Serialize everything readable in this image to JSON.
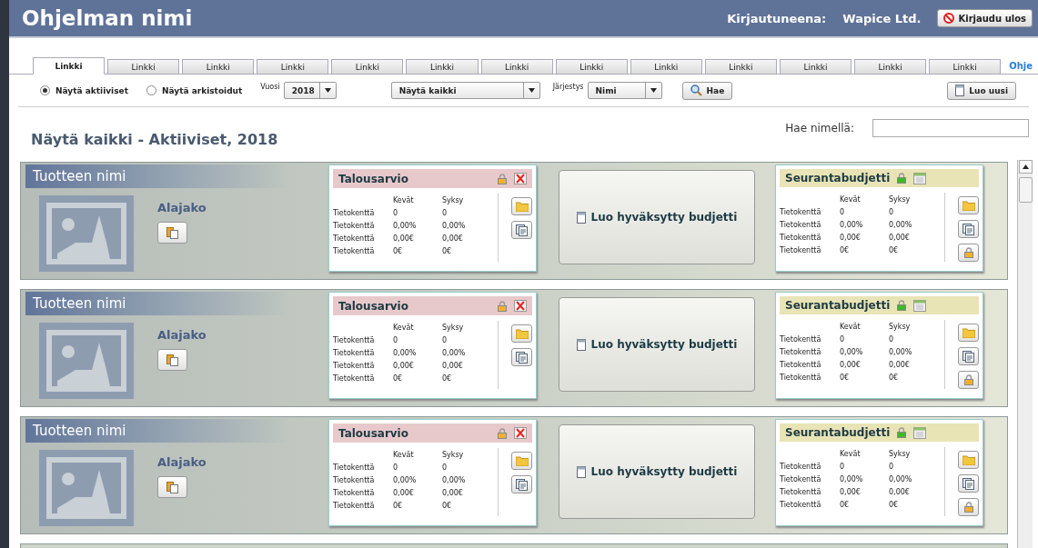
{
  "header": {
    "title": "Ohjelman nimi",
    "user_label": "Kirjautuneena:",
    "user_name": "Wapice Ltd.",
    "logout": "Kirjaudu ulos"
  },
  "tabs": [
    {
      "label": "Linkki",
      "selected": true
    },
    {
      "label": "Linkki",
      "selected": false
    },
    {
      "label": "Linkki",
      "selected": false
    },
    {
      "label": "Linkki",
      "selected": false
    },
    {
      "label": "Linkki",
      "selected": false
    },
    {
      "label": "Linkki",
      "selected": false
    },
    {
      "label": "Linkki",
      "selected": false
    },
    {
      "label": "Linkki",
      "selected": false
    },
    {
      "label": "Linkki",
      "selected": false
    },
    {
      "label": "Linkki",
      "selected": false
    },
    {
      "label": "Linkki",
      "selected": false
    },
    {
      "label": "Linkki",
      "selected": false
    },
    {
      "label": "Linkki",
      "selected": false
    }
  ],
  "help_link": "Ohje",
  "toolbar": {
    "radios": [
      {
        "label": "Näytä aktiiviset",
        "selected": true
      },
      {
        "label": "Näytä arkistoidut",
        "selected": false
      }
    ],
    "year": {
      "label": "Vuosi",
      "value": "2018"
    },
    "filter": {
      "value": "Näytä kaikki"
    },
    "sort": {
      "label": "Järjestys",
      "value": "Nimi"
    },
    "search_button": "Hae",
    "new_button": "Luo uusi"
  },
  "section_title": "Näytä kaikki - Aktiiviset, 2018",
  "name_search": {
    "label": "Hae nimellä:"
  },
  "products": [
    {
      "name": "Tuotteen nimi",
      "subcategory": "Alajako",
      "budget": {
        "title": "Talousarvio",
        "columns": [
          "Kevät",
          "Syksy"
        ],
        "rows": [
          {
            "label": "Tietokenttä",
            "values": [
              "0",
              "0"
            ]
          },
          {
            "label": "Tietokenttä",
            "values": [
              "0,00%",
              "0,00%"
            ]
          },
          {
            "label": "Tietokenttä",
            "values": [
              "0,00€",
              "0,00€"
            ]
          },
          {
            "label": "Tietokenttä",
            "values": [
              "0€",
              "0€"
            ]
          }
        ]
      },
      "create_button": "Luo hyväksytty budjetti",
      "tracking": {
        "title": "Seurantabudjetti",
        "columns": [
          "Kevät",
          "Syksy"
        ],
        "rows": [
          {
            "label": "Tietokenttä",
            "values": [
              "0",
              "0"
            ]
          },
          {
            "label": "Tietokenttä",
            "values": [
              "0,00%",
              "0,00%"
            ]
          },
          {
            "label": "Tietokenttä",
            "values": [
              "0,00€",
              "0,00€"
            ]
          },
          {
            "label": "Tietokenttä",
            "values": [
              "0€",
              "0€"
            ]
          }
        ]
      }
    },
    {
      "name": "Tuotteen nimi",
      "subcategory": "Alajako",
      "budget": {
        "title": "Talousarvio",
        "columns": [
          "Kevät",
          "Syksy"
        ],
        "rows": [
          {
            "label": "Tietokenttä",
            "values": [
              "0",
              "0"
            ]
          },
          {
            "label": "Tietokenttä",
            "values": [
              "0,00%",
              "0,00%"
            ]
          },
          {
            "label": "Tietokenttä",
            "values": [
              "0,00€",
              "0,00€"
            ]
          },
          {
            "label": "Tietokenttä",
            "values": [
              "0€",
              "0€"
            ]
          }
        ]
      },
      "create_button": "Luo hyväksytty budjetti",
      "tracking": {
        "title": "Seurantabudjetti",
        "columns": [
          "Kevät",
          "Syksy"
        ],
        "rows": [
          {
            "label": "Tietokenttä",
            "values": [
              "0",
              "0"
            ]
          },
          {
            "label": "Tietokenttä",
            "values": [
              "0,00%",
              "0,00%"
            ]
          },
          {
            "label": "Tietokenttä",
            "values": [
              "0,00€",
              "0,00€"
            ]
          },
          {
            "label": "Tietokenttä",
            "values": [
              "0€",
              "0€"
            ]
          }
        ]
      }
    },
    {
      "name": "Tuotteen nimi",
      "subcategory": "Alajako",
      "budget": {
        "title": "Talousarvio",
        "columns": [
          "Kevät",
          "Syksy"
        ],
        "rows": [
          {
            "label": "Tietokenttä",
            "values": [
              "0",
              "0"
            ]
          },
          {
            "label": "Tietokenttä",
            "values": [
              "0,00%",
              "0,00%"
            ]
          },
          {
            "label": "Tietokenttä",
            "values": [
              "0,00€",
              "0,00€"
            ]
          },
          {
            "label": "Tietokenttä",
            "values": [
              "0€",
              "0€"
            ]
          }
        ]
      },
      "create_button": "Luo hyväksytty budjetti",
      "tracking": {
        "title": "Seurantabudjetti",
        "columns": [
          "Kevät",
          "Syksy"
        ],
        "rows": [
          {
            "label": "Tietokenttä",
            "values": [
              "0",
              "0"
            ]
          },
          {
            "label": "Tietokenttä",
            "values": [
              "0,00%",
              "0,00%"
            ]
          },
          {
            "label": "Tietokenttä",
            "values": [
              "0,00€",
              "0,00€"
            ]
          },
          {
            "label": "Tietokenttä",
            "values": [
              "0€",
              "0€"
            ]
          }
        ]
      }
    }
  ]
}
